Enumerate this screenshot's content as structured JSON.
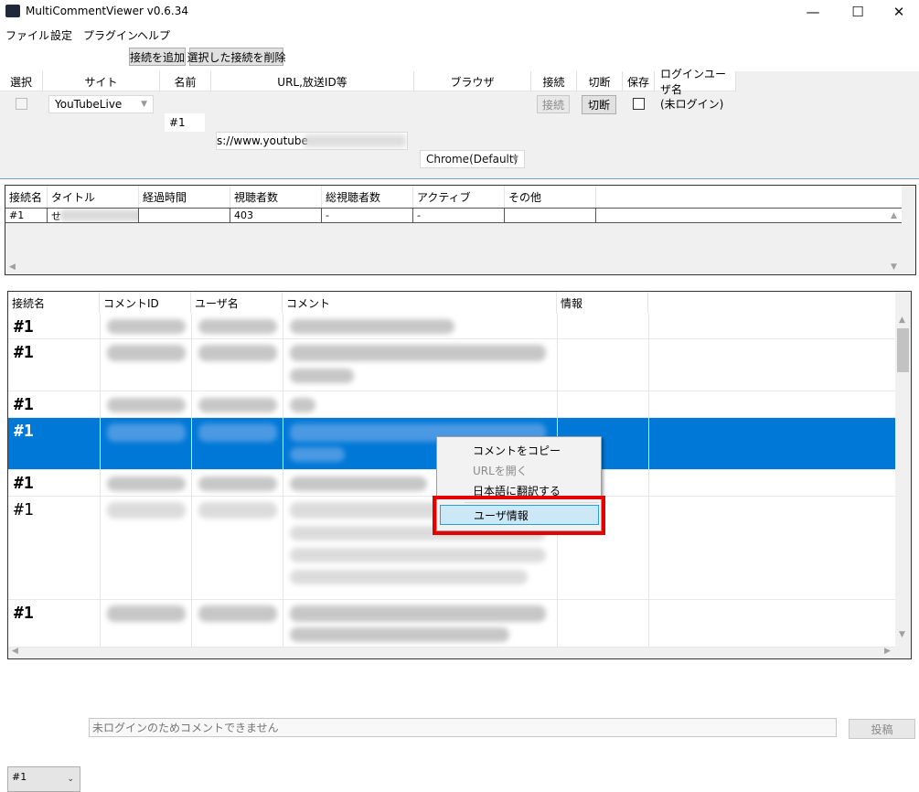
{
  "window": {
    "title": "MultiCommentViewer v0.6.34",
    "minimize": "—",
    "maximize": "☐",
    "close": "✕"
  },
  "menu": [
    "ファイル",
    "設定",
    "プラグイン",
    "ヘルプ"
  ],
  "toolbar": {
    "add_connection": "接続を追加",
    "remove_connection": "選択した接続を削除"
  },
  "connections": {
    "headers": [
      "選択",
      "サイト",
      "名前",
      "URL,放送ID等",
      "ブラウザ",
      "接続",
      "切断",
      "保存",
      "ログインユーザ名"
    ],
    "row": {
      "site": "YouTubeLive",
      "name": "#1",
      "url": "s://www.youtube",
      "browser": "Chrome(Default)",
      "connect": "接続",
      "disconnect": "切断",
      "login_user": "(未ログイン)"
    }
  },
  "streams": {
    "headers": [
      "接続名",
      "タイトル",
      "経過時間",
      "視聴者数",
      "総視聴者数",
      "アクティブ",
      "その他"
    ],
    "rows": [
      {
        "conn": "#1",
        "title": "せ",
        "elapsed": "",
        "viewers": "403",
        "total": "-",
        "active": "-",
        "other": ""
      }
    ]
  },
  "comments": {
    "headers": [
      "接続名",
      "コメントID",
      "ユーザ名",
      "コメント",
      "情報"
    ],
    "rows": [
      {
        "conn": "#1"
      },
      {
        "conn": "#1"
      },
      {
        "conn": "#1"
      },
      {
        "conn": "#1"
      },
      {
        "conn": "#1"
      },
      {
        "conn": "#1"
      },
      {
        "conn": "#1"
      }
    ]
  },
  "context_menu": {
    "items": [
      "コメントをコピー",
      "URLを開く",
      "日本語に翻訳する",
      "ユーザ情報"
    ]
  },
  "bottom": {
    "selector": "#1",
    "placeholder": "未ログインのためコメントできません",
    "post": "投稿"
  }
}
